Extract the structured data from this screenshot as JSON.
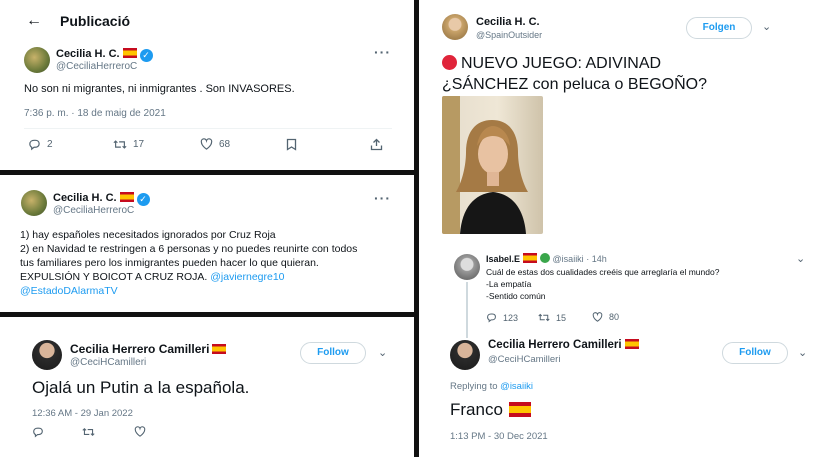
{
  "p1": {
    "back_icon": "arrow-left-icon",
    "title": "Publicació",
    "name": "Cecilia H. C.",
    "handle": "@CeciliaHerreroC",
    "text": "No son ni migrantes, ni inmigrantes . Son INVASORES.",
    "time": "7:36 p. m. · 18 de maig de 2021",
    "reply_count": "2",
    "retweet_count": "17",
    "like_count": "68"
  },
  "p2": {
    "name": "Cecilia H. C.",
    "handle": "@CeciliaHerreroC",
    "line1": "1) hay españoles necesitados ignorados por Cruz Roja",
    "line2": "2) en Navidad te restringen a 6 personas y no puedes reunirte con todos",
    "line3": "tus familiares pero los inmigrantes pueden hacer lo que quieran.",
    "line4": "EXPULSIÓN Y BOICOT A CRUZ ROJA.",
    "mention1": "@javiernegre10",
    "mention2": "@EstadoDAlarmaTV"
  },
  "p3": {
    "name": "Cecilia Herrero Camilleri",
    "handle": "@CeciHCamilleri",
    "follow_label": "Follow",
    "text": "Ojalá un Putin a la española.",
    "time": "12:36 AM - 29 Jan 2022"
  },
  "p4": {
    "name": "Cecilia H. C.",
    "handle": "@SpainOutsider",
    "follow_label": "Folgen",
    "line1": "NUEVO JUEGO: ADIVINAD",
    "line2": "¿SÁNCHEZ con peluca o BEGOÑO?",
    "reply_name": "Isabel.E",
    "reply_handle": "@isaiiki",
    "reply_time": "· 14h",
    "reply_q": "Cuál de estas dos cualidades creéis que arreglaría el mundo?",
    "reply_o1": "-La empatía",
    "reply_o2": "-Sentido común",
    "reply_replies": "123",
    "reply_retweets": "15",
    "reply_likes": "80",
    "quote_name": "Cecilia Herrero Camilleri",
    "quote_handle": "@CeciHCamilleri",
    "quote_follow": "Follow",
    "replying_prefix": "Replying to",
    "replying_to": "@isaiiki",
    "quote_text": "Franco",
    "quote_time": "1:13 PM - 30 Dec 2021"
  },
  "colors": {
    "link": "#1d9bf0",
    "muted": "#657786",
    "divider": "#111111"
  }
}
